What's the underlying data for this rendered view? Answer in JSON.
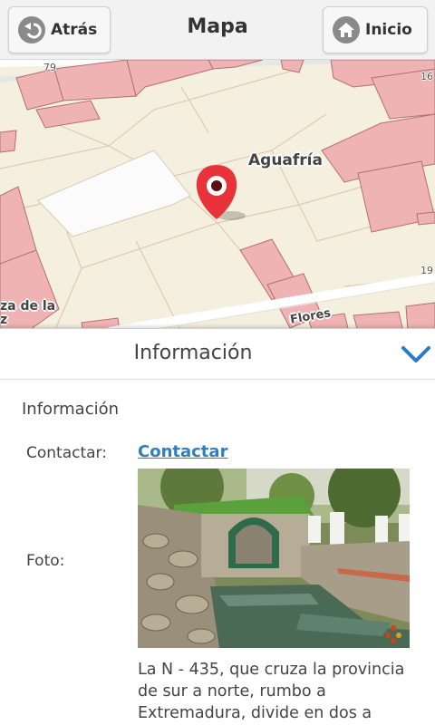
{
  "header": {
    "back_label": "Atrás",
    "title": "Mapa",
    "home_label": "Inicio"
  },
  "map": {
    "place_name": "Aguafría",
    "street_left": "za de la",
    "street_left_2": "z",
    "street_bottom": "Flores",
    "house_numbers": [
      "79",
      "16",
      "19"
    ]
  },
  "panel": {
    "title": "Información",
    "section_title": "Información",
    "contact_label": "Contactar:",
    "contact_link": "Contactar",
    "photo_label": "Foto:",
    "description": "La N - 435, que cruza la provincia de sur a norte, rumbo a Extremadura, divide en dos a"
  },
  "colors": {
    "building": "#f0b3b3",
    "land": "#f5efe0",
    "pin": "#e8333a",
    "link": "#2f7fc0",
    "chevron": "#2b7ac6"
  }
}
